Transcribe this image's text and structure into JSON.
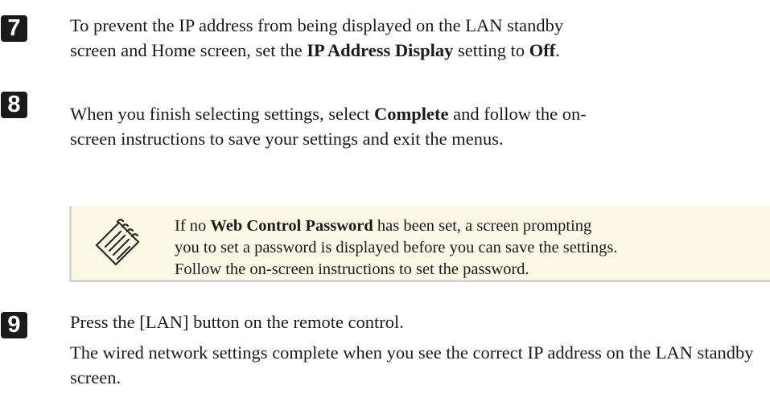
{
  "steps": [
    {
      "number": "7",
      "line1": "To prevent the IP address from being displayed on the LAN standby",
      "line2_a": "screen and Home screen, set the ",
      "line2_b": "IP Address Display",
      "line2_c": " setting to ",
      "line2_d": "Off",
      "line2_e": "."
    },
    {
      "number": "8",
      "a": "When you finish selecting settings, select ",
      "b": "Complete",
      "c": " and follow the on-",
      "d": "screen instructions to save your settings and exit the menus."
    },
    {
      "number": "9",
      "line1": "Press the [LAN] button on the remote control.",
      "para2": "The wired network settings complete when you see the correct IP address on the LAN standby screen."
    }
  ],
  "note": {
    "icon": "note-pad-icon",
    "a": "If no ",
    "b": "Web Control Password",
    "c": " has been set, a screen prompting",
    "d": "you to set a password is displayed before you can save the settings.",
    "e": "Follow the on-screen instructions to set the password."
  }
}
